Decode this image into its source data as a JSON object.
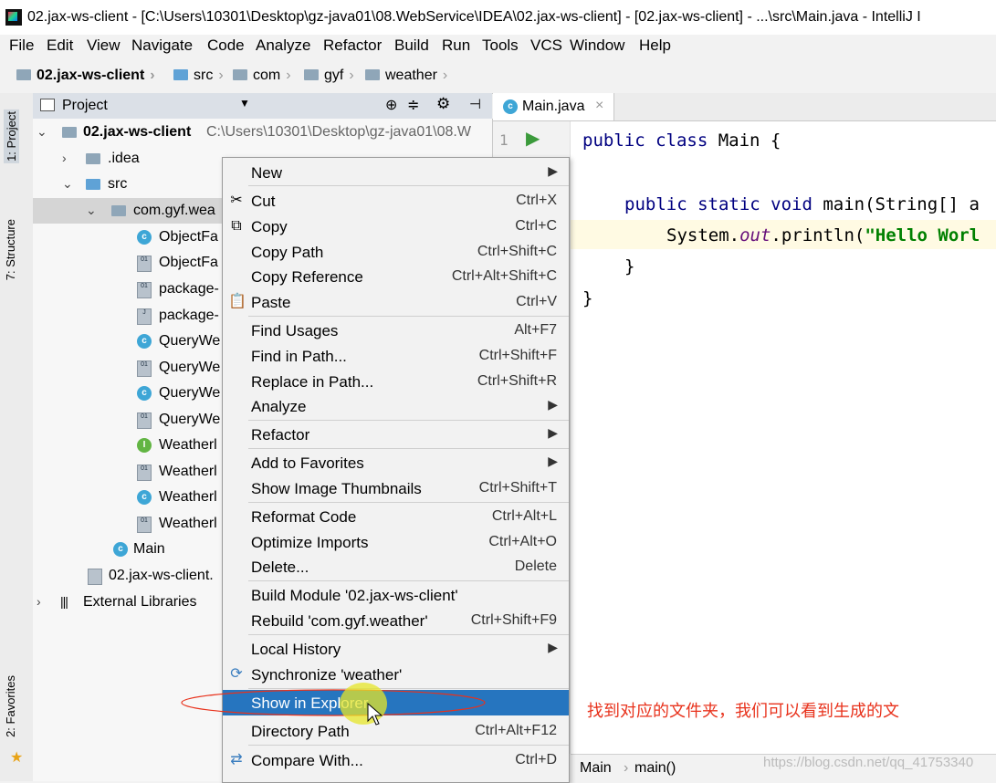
{
  "window": {
    "title": "02.jax-ws-client - [C:\\Users\\10301\\Desktop\\gz-java01\\08.WebService\\IDEA\\02.jax-ws-client] - [02.jax-ws-client] - ...\\src\\Main.java - IntelliJ I"
  },
  "menubar": [
    "File",
    "Edit",
    "View",
    "Navigate",
    "Code",
    "Analyze",
    "Refactor",
    "Build",
    "Run",
    "Tools",
    "VCS",
    "Window",
    "Help"
  ],
  "breadcrumb": [
    "02.jax-ws-client",
    "src",
    "com",
    "gyf",
    "weather"
  ],
  "side_tabs": {
    "project": "1: Project",
    "structure": "7: Structure",
    "favorites": "2: Favorites"
  },
  "project_panel": {
    "header": "Project",
    "root_label": "02.jax-ws-client",
    "root_path": "C:\\Users\\10301\\Desktop\\gz-java01\\08.W",
    "idea": ".idea",
    "src": "src",
    "package": "com.gyf.wea",
    "files": [
      "ObjectFa",
      "ObjectFa",
      "package-",
      "package-",
      "QueryWe",
      "QueryWe",
      "QueryWe",
      "QueryWe",
      "Weatherl",
      "Weatherl",
      "Weatherl",
      "Weatherl"
    ],
    "main": "Main",
    "iml": "02.jax-ws-client.",
    "external": "External Libraries"
  },
  "editor": {
    "tab": "Main.java",
    "line_number": "1",
    "code": {
      "l1_kw": "public class",
      "l1_rest": " Main {",
      "l3_kw": "public static void",
      "l3_rest": " main(String[] a",
      "l4_a": "System.",
      "l4_out": "out",
      "l4_b": ".println(",
      "l4_str": "\"Hello Worl",
      "l5": "}",
      "l6": "}"
    },
    "status": "Main",
    "status2": "main()"
  },
  "context_menu": {
    "new": "New",
    "cut": "Cut",
    "cut_sc": "Ctrl+X",
    "copy": "Copy",
    "copy_sc": "Ctrl+C",
    "copy_path": "Copy Path",
    "copy_path_sc": "Ctrl+Shift+C",
    "copy_ref": "Copy Reference",
    "copy_ref_sc": "Ctrl+Alt+Shift+C",
    "paste": "Paste",
    "paste_sc": "Ctrl+V",
    "find_usages": "Find Usages",
    "find_usages_sc": "Alt+F7",
    "find_in_path": "Find in Path...",
    "find_in_path_sc": "Ctrl+Shift+F",
    "replace_in_path": "Replace in Path...",
    "replace_in_path_sc": "Ctrl+Shift+R",
    "analyze": "Analyze",
    "refactor": "Refactor",
    "add_fav": "Add to Favorites",
    "thumbs": "Show Image Thumbnails",
    "thumbs_sc": "Ctrl+Shift+T",
    "reformat": "Reformat Code",
    "reformat_sc": "Ctrl+Alt+L",
    "optimize": "Optimize Imports",
    "optimize_sc": "Ctrl+Alt+O",
    "delete": "Delete...",
    "delete_sc": "Delete",
    "build_module": "Build Module '02.jax-ws-client'",
    "rebuild": "Rebuild 'com.gyf.weather'",
    "rebuild_sc": "Ctrl+Shift+F9",
    "local_history": "Local History",
    "sync": "Synchronize 'weather'",
    "show_explorer": "Show in Explorer",
    "dir_path": "Directory Path",
    "dir_path_sc": "Ctrl+Alt+F12",
    "compare": "Compare With...",
    "compare_sc": "Ctrl+D"
  },
  "annotation": "找到对应的文件夹，我们可以看到生成的文",
  "watermark": "https://blog.csdn.net/qq_41753340"
}
